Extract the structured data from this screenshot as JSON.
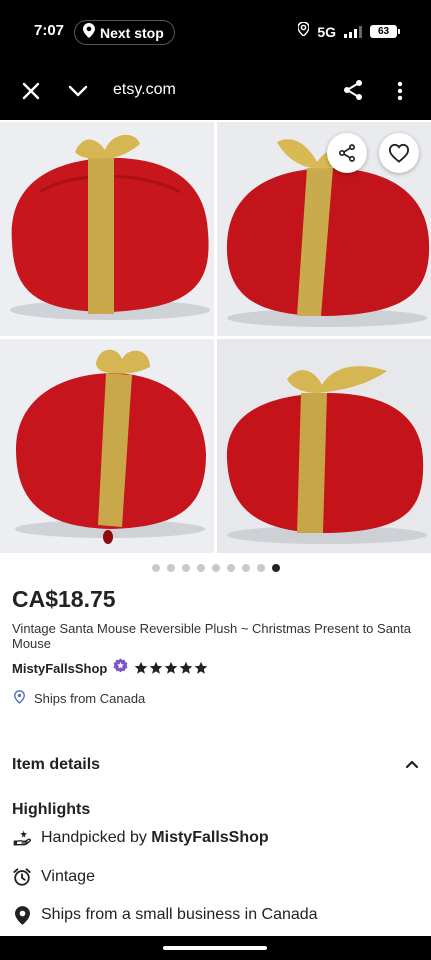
{
  "status_bar": {
    "time": "7:07",
    "next_stop": "Next stop",
    "network": "5G",
    "battery": "63"
  },
  "browser": {
    "url": "etsy.com"
  },
  "gallery": {
    "total_images": 9,
    "active_index": 8,
    "photo_alts": [
      "red-present-plush-front",
      "red-present-plush-right",
      "red-present-plush-left",
      "red-present-plush-back"
    ]
  },
  "listing": {
    "price": "CA$18.75",
    "title": "Vintage Santa Mouse Reversible Plush ~ Christmas Present to Santa Mouse",
    "shop_name": "MistyFallsShop",
    "rating_stars": 5,
    "ships_from": "Ships from Canada"
  },
  "item_details": {
    "header": "Item details",
    "highlights_title": "Highlights",
    "highlights": {
      "handpicked_prefix": "Handpicked by ",
      "handpicked_shop": "MistyFallsShop",
      "vintage": "Vintage",
      "ships_small_business": "Ships from a small business in Canada"
    }
  },
  "colors": {
    "accent_badge": "#7b56c7",
    "location_pin": "#4a6fc7",
    "text_primary": "#222222"
  }
}
